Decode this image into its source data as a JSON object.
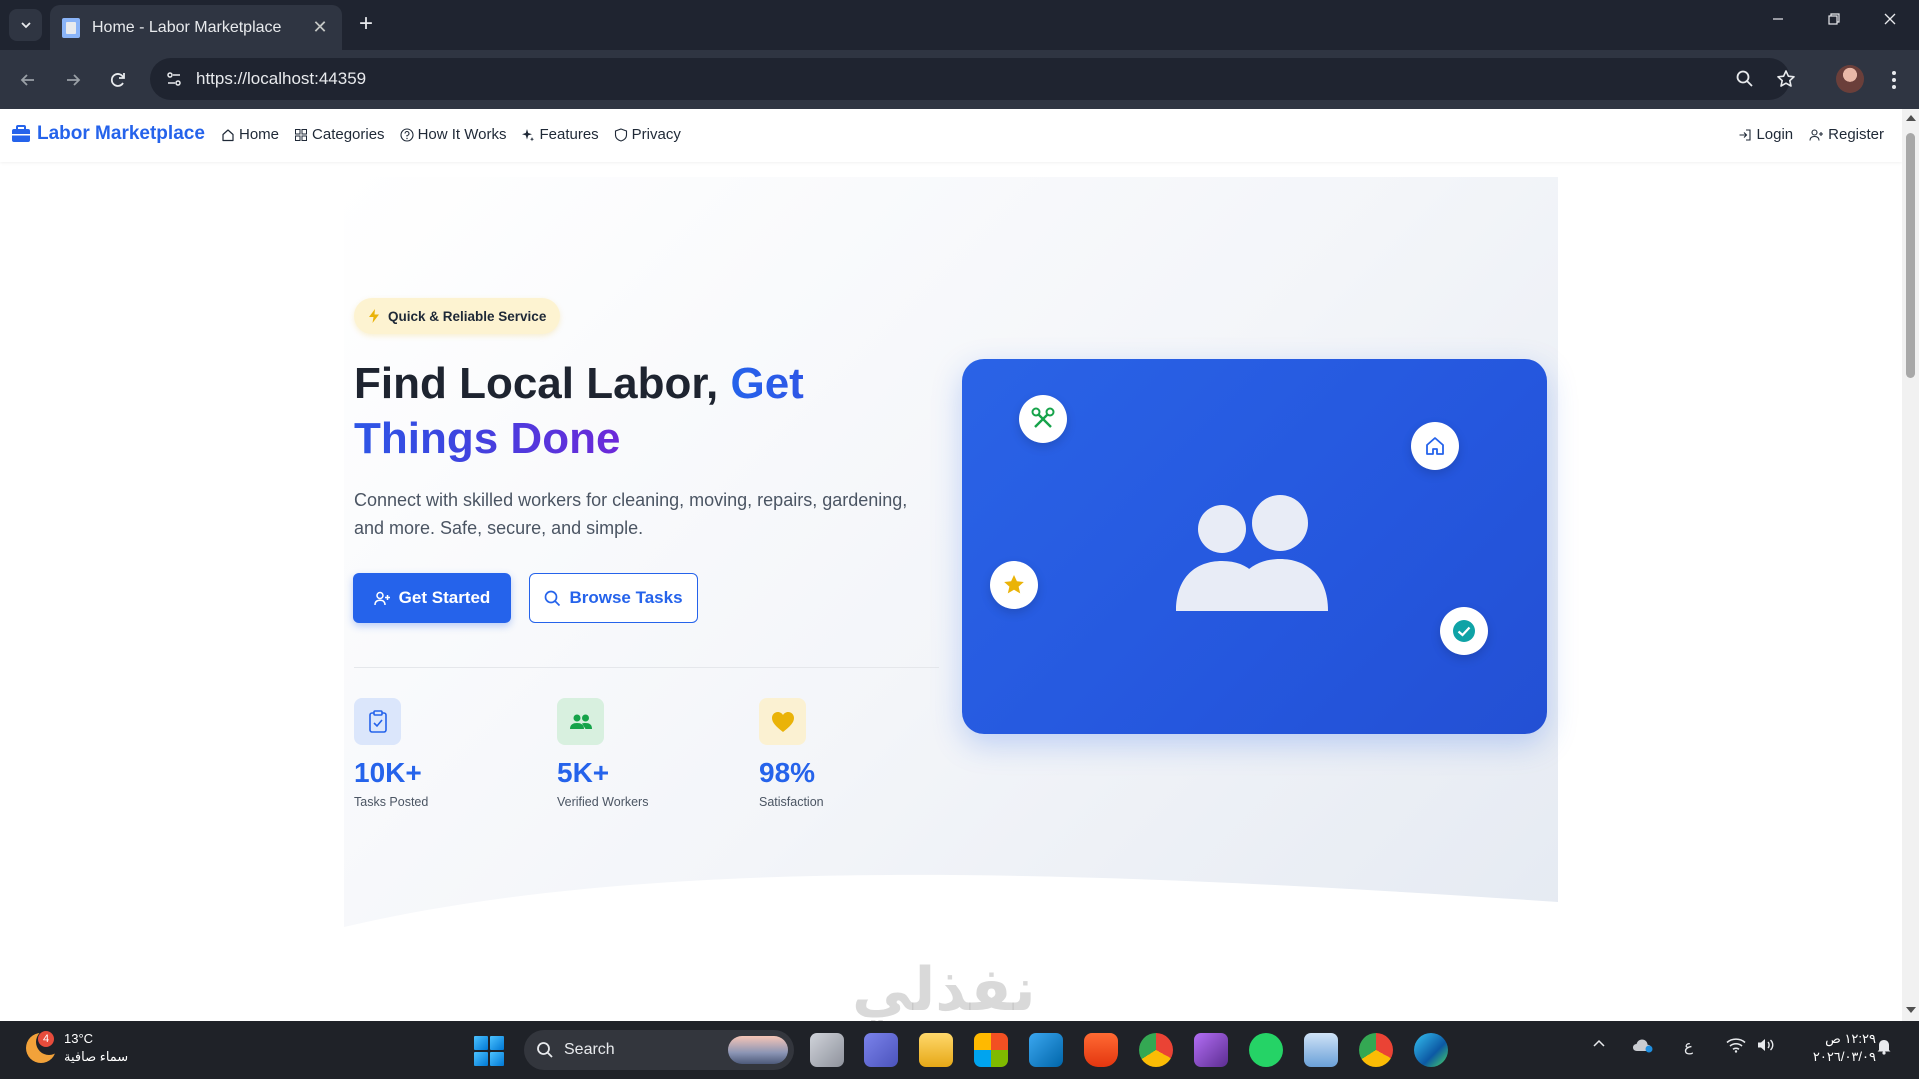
{
  "browser": {
    "tab_title": "Home - Labor Marketplace",
    "url": "https://localhost:44359"
  },
  "nav": {
    "brand": "Labor Marketplace",
    "links": [
      {
        "label": "Home",
        "icon": "home-icon"
      },
      {
        "label": "Categories",
        "icon": "grid-icon"
      },
      {
        "label": "How It Works",
        "icon": "question-circle-icon"
      },
      {
        "label": "Features",
        "icon": "sparkle-icon"
      },
      {
        "label": "Privacy",
        "icon": "shield-icon"
      }
    ],
    "login": "Login",
    "register": "Register"
  },
  "hero": {
    "badge": "Quick & Reliable Service",
    "title_plain": "Find Local Labor, ",
    "title_highlight": "Get Things Done",
    "subtitle": "Connect with skilled workers for cleaning, moving, repairs, gardening, and more. Safe, secure, and simple.",
    "primary_button": "Get Started",
    "secondary_button": "Browse Tasks",
    "stats": [
      {
        "value": "10K+",
        "label": "Tasks Posted",
        "icon": "clipboard-check-icon",
        "color": "#2563eb"
      },
      {
        "value": "5K+",
        "label": "Verified Workers",
        "icon": "people-icon",
        "color": "#16a34a"
      },
      {
        "value": "98%",
        "label": "Satisfaction",
        "icon": "heart-icon",
        "color": "#eab308"
      }
    ]
  },
  "colors": {
    "accent": "#2563eb",
    "accent_purple": "#6d28d9",
    "badge_bg": "#fdf3d1"
  },
  "watermark": "نفذلي",
  "taskbar": {
    "weather_temp": "13°C",
    "weather_desc": "سماء صافية",
    "weather_badge": "4",
    "search": "Search",
    "time": "١٢:٢٩ ص",
    "date": "٢٠٢٦/٠٣/٠٩",
    "lang": "ع"
  }
}
